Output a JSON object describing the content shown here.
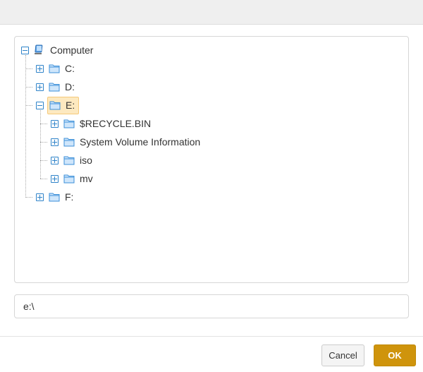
{
  "tree": {
    "root": {
      "label": "Computer",
      "icon": "computer-icon",
      "state": "expanded"
    },
    "drives": [
      {
        "label": "C:",
        "icon": "folder-icon",
        "state": "collapsed"
      },
      {
        "label": "D:",
        "icon": "folder-icon",
        "state": "collapsed"
      },
      {
        "label": "E:",
        "icon": "folder-icon",
        "state": "expanded",
        "selected": true,
        "children": [
          {
            "label": "$RECYCLE.BIN",
            "icon": "folder-icon",
            "state": "collapsed"
          },
          {
            "label": "System Volume Information",
            "icon": "folder-icon",
            "state": "collapsed"
          },
          {
            "label": "iso",
            "icon": "folder-icon",
            "state": "collapsed"
          },
          {
            "label": "mv",
            "icon": "folder-icon",
            "state": "collapsed"
          }
        ]
      },
      {
        "label": "F:",
        "icon": "folder-icon",
        "state": "collapsed"
      }
    ]
  },
  "path_field": {
    "value": "e:\\"
  },
  "buttons": {
    "cancel": "Cancel",
    "ok": "OK"
  },
  "colors": {
    "toggle": "#2f83c9",
    "folder": "#3b8fd8",
    "selection_bg": "#fde9c0",
    "ok_button": "#cf940c"
  }
}
